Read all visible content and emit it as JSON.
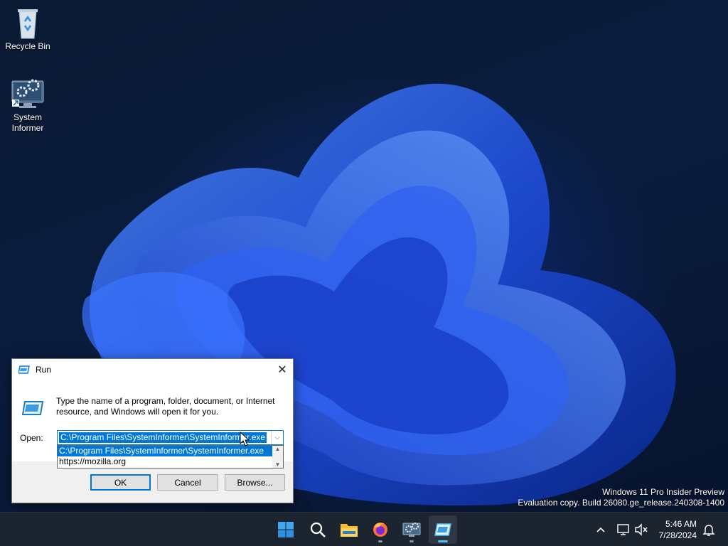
{
  "desktop": {
    "icons": [
      {
        "label": "Recycle Bin"
      },
      {
        "label": "System Informer"
      }
    ],
    "watermark": {
      "line1": "Windows 11 Pro Insider Preview",
      "line2": "Evaluation copy. Build 26080.ge_release.240308-1400"
    }
  },
  "run_dialog": {
    "title": "Run",
    "close_symbol": "✕",
    "description": "Type the name of a program, folder, document, or Internet resource, and Windows will open it for you.",
    "open_label": "Open:",
    "open_value": "C:\\Program Files\\SystemInformer\\SystemInformer.exe",
    "dropdown_arrow": "⌵",
    "dropdown_items": [
      "C:\\Program Files\\SystemInformer\\SystemInformer.exe",
      "https://mozilla.org"
    ],
    "buttons": {
      "ok": "OK",
      "cancel": "Cancel",
      "browse": "Browse..."
    }
  },
  "taskbar": {
    "apps": [
      {
        "icon": "windows-start-icon"
      },
      {
        "icon": "search-icon"
      },
      {
        "icon": "file-explorer-icon"
      },
      {
        "icon": "firefox-icon"
      },
      {
        "icon": "system-informer-icon"
      },
      {
        "icon": "run-icon",
        "active": true
      }
    ],
    "tray": {
      "chevron": "^",
      "time": "5:46 AM",
      "date": "7/28/2024"
    }
  },
  "colors": {
    "accent": "#0078d7",
    "taskbar_bg": "#1c2430",
    "active_indicator": "#4cc2ff"
  }
}
